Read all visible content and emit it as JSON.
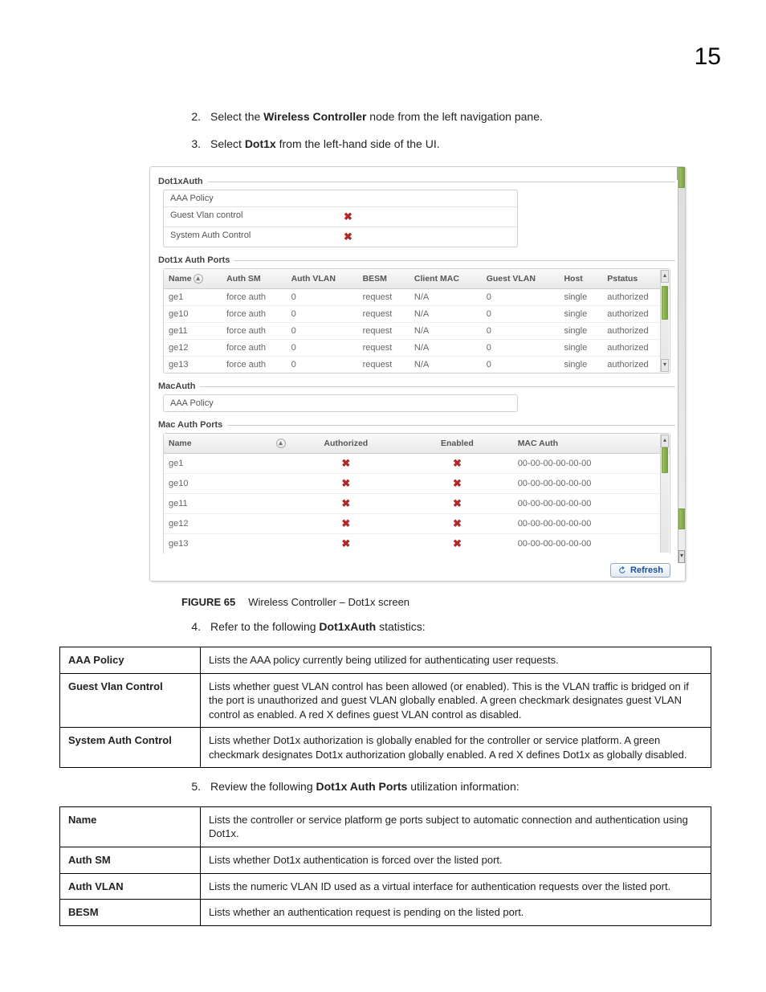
{
  "page_number": "15",
  "steps": {
    "s2_num": "2.",
    "s2_a": "Select the ",
    "s2_b": "Wireless Controller",
    "s2_c": " node from the left navigation pane.",
    "s3_num": "3.",
    "s3_a": "Select ",
    "s3_b": "Dot1x",
    "s3_c": " from the left-hand side of the UI.",
    "s4_num": "4.",
    "s4_a": "Refer to the following ",
    "s4_b": "Dot1xAuth",
    "s4_c": " statistics:",
    "s5_num": "5.",
    "s5_a": "Review the following ",
    "s5_b": "Dot1x Auth Ports",
    "s5_c": " utilization information:"
  },
  "ui": {
    "dot1xauth": "Dot1xAuth",
    "aaa_policy": "AAA Policy",
    "guest_vlan_control": "Guest Vlan control",
    "system_auth_control": "System Auth Control",
    "dot1x_auth_ports": "Dot1x Auth Ports",
    "macauth": "MacAuth",
    "mac_auth_ports": "Mac Auth Ports",
    "refresh": "Refresh",
    "x": "✖",
    "dot1x_headers": {
      "name": "Name",
      "authsm": "Auth SM",
      "authvlan": "Auth VLAN",
      "besm": "BESM",
      "clientmac": "Client MAC",
      "guestvlan": "Guest VLAN",
      "host": "Host",
      "pstatus": "Pstatus"
    },
    "dot1x_rows": [
      {
        "name": "ge1",
        "authsm": "force auth",
        "authvlan": "0",
        "besm": "request",
        "clientmac": "N/A",
        "guestvlan": "0",
        "host": "single",
        "pstatus": "authorized"
      },
      {
        "name": "ge10",
        "authsm": "force auth",
        "authvlan": "0",
        "besm": "request",
        "clientmac": "N/A",
        "guestvlan": "0",
        "host": "single",
        "pstatus": "authorized"
      },
      {
        "name": "ge11",
        "authsm": "force auth",
        "authvlan": "0",
        "besm": "request",
        "clientmac": "N/A",
        "guestvlan": "0",
        "host": "single",
        "pstatus": "authorized"
      },
      {
        "name": "ge12",
        "authsm": "force auth",
        "authvlan": "0",
        "besm": "request",
        "clientmac": "N/A",
        "guestvlan": "0",
        "host": "single",
        "pstatus": "authorized"
      },
      {
        "name": "ge13",
        "authsm": "force auth",
        "authvlan": "0",
        "besm": "request",
        "clientmac": "N/A",
        "guestvlan": "0",
        "host": "single",
        "pstatus": "authorized"
      }
    ],
    "mac_headers": {
      "name": "Name",
      "authorized": "Authorized",
      "enabled": "Enabled",
      "macauth": "MAC Auth"
    },
    "mac_rows": [
      {
        "name": "ge1",
        "mac": "00-00-00-00-00-00"
      },
      {
        "name": "ge10",
        "mac": "00-00-00-00-00-00"
      },
      {
        "name": "ge11",
        "mac": "00-00-00-00-00-00"
      },
      {
        "name": "ge12",
        "mac": "00-00-00-00-00-00"
      },
      {
        "name": "ge13",
        "mac": "00-00-00-00-00-00"
      }
    ]
  },
  "figure": {
    "lead": "FIGURE 65",
    "caption": "Wireless Controller – Dot1x screen"
  },
  "table_a": {
    "r1k": "AAA Policy",
    "r1v": "Lists the AAA policy currently being utilized for authenticating user requests.",
    "r2k": "Guest Vlan Control",
    "r2v": "Lists whether guest VLAN control has been allowed (or enabled). This is the VLAN traffic is bridged on if the port is unauthorized and guest VLAN globally enabled. A green checkmark designates guest VLAN control as enabled. A red X defines guest VLAN control as disabled.",
    "r3k": "System Auth Control",
    "r3v": "Lists whether Dot1x authorization is globally enabled for the controller or service platform. A green checkmark designates Dot1x authorization globally enabled. A red X defines Dot1x as globally disabled."
  },
  "table_b": {
    "r1k": "Name",
    "r1v": "Lists the controller or service platform ge ports subject to automatic connection and authentication using Dot1x.",
    "r2k": "Auth SM",
    "r2v": "Lists whether Dot1x authentication is forced over the listed port.",
    "r3k": "Auth VLAN",
    "r3v": "Lists the numeric VLAN ID used as a virtual interface for authentication requests over the listed port.",
    "r4k": "BESM",
    "r4v": "Lists whether an authentication request is pending on the listed port."
  }
}
